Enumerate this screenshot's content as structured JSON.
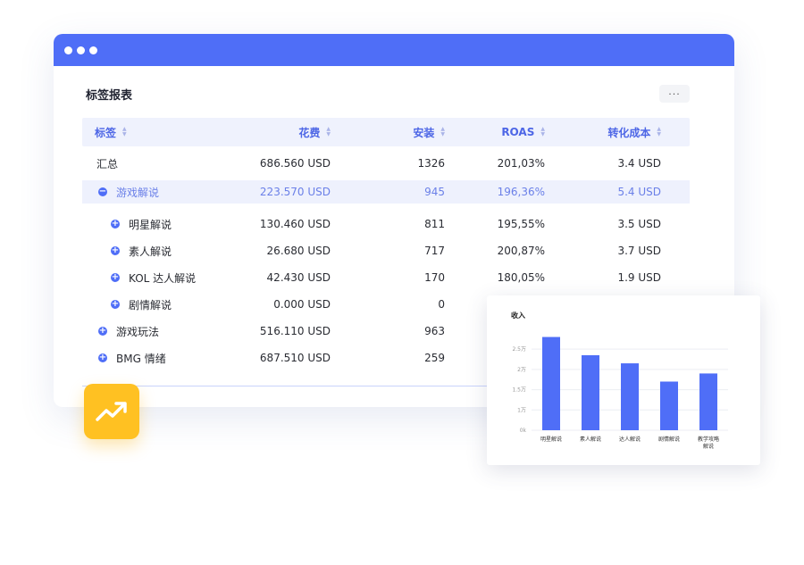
{
  "report": {
    "title": "标签报表",
    "more_label": "···",
    "columns": [
      "标签",
      "花费",
      "安装",
      "ROAS",
      "转化成本"
    ],
    "rows": [
      {
        "label": "汇总",
        "spend": "686.560 USD",
        "install": "1326",
        "roas": "201,03%",
        "cost": "3.4 USD"
      },
      {
        "label": "游戏解说",
        "spend": "223.570 USD",
        "install": "945",
        "roas": "196,36%",
        "cost": "5.4 USD"
      },
      {
        "label": "明星解说",
        "spend": "130.460 USD",
        "install": "811",
        "roas": "195,55%",
        "cost": "3.5 USD"
      },
      {
        "label": "素人解说",
        "spend": "26.680 USD",
        "install": "717",
        "roas": "200,87%",
        "cost": "3.7 USD"
      },
      {
        "label": "KOL 达人解说",
        "spend": "42.430 USD",
        "install": "170",
        "roas": "180,05%",
        "cost": "1.9 USD"
      },
      {
        "label": "剧情解说",
        "spend": "0.000 USD",
        "install": "0",
        "roas": "",
        "cost": ""
      },
      {
        "label": "游戏玩法",
        "spend": "516.110 USD",
        "install": "963",
        "roas": "",
        "cost": ""
      },
      {
        "label": "BMG 情绪",
        "spend": "687.510 USD",
        "install": "259",
        "roas": "",
        "cost": ""
      }
    ]
  },
  "icons": {
    "collapse": "minus-circle-icon",
    "expand": "plus-circle-icon",
    "sort": "sort-icon",
    "trend": "trending-up-icon"
  },
  "colors": {
    "accent": "#4f6ef7",
    "header_bg": "#eff2fd",
    "badge": "#ffc122"
  },
  "chart_data": {
    "type": "bar",
    "title": "收入",
    "categories": [
      "明星解说",
      "素人解说",
      "达人解说",
      "剧情解说",
      "教学攻略解说"
    ],
    "values": [
      2.3,
      1.85,
      1.65,
      1.2,
      1.4
    ],
    "yticks": [
      "0k",
      "1万",
      "1.5万",
      "2万",
      "2.5万"
    ],
    "ytick_values": [
      0,
      0.5,
      1,
      1.5,
      2
    ],
    "ylim": [
      0,
      2.4
    ],
    "grid": true,
    "color": "#4f6ef7"
  }
}
